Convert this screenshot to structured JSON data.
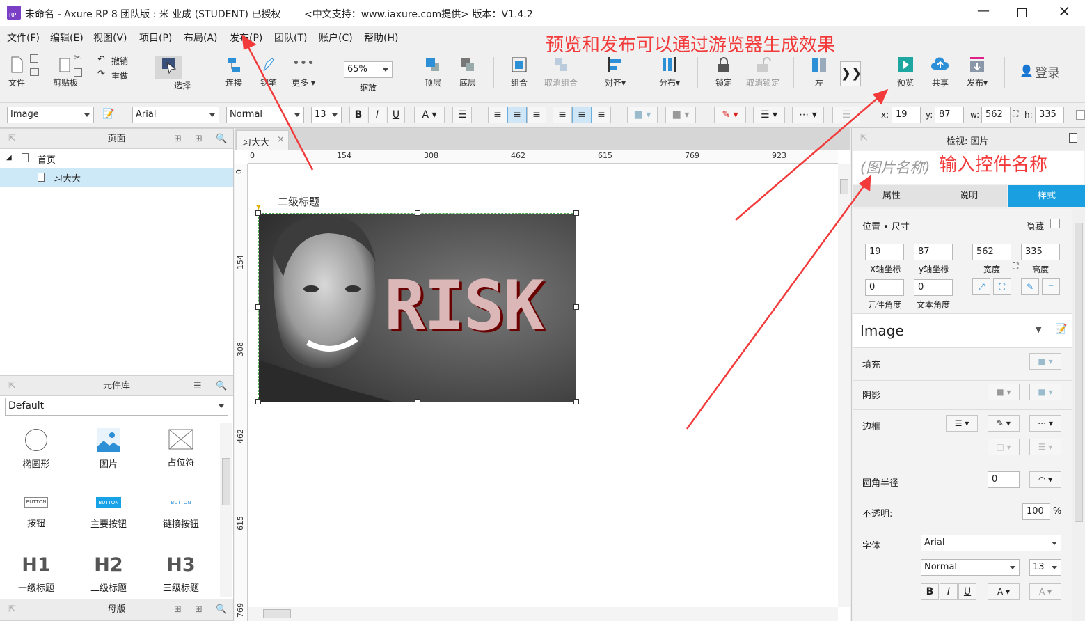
{
  "window": {
    "title": "未命名 - Axure RP 8 团队版 : 米 业成 (STUDENT) 已授权",
    "support": "<中文支持：www.iaxure.com提供> 版本：V1.4.2"
  },
  "menu": [
    "文件(F)",
    "编辑(E)",
    "视图(V)",
    "项目(P)",
    "布局(A)",
    "发布(P)",
    "团队(T)",
    "账户(C)",
    "帮助(H)"
  ],
  "toolbar": {
    "file": "文件",
    "clipboard": "剪贴板",
    "undo": "撤销",
    "redo": "重做",
    "select": "选择",
    "connect": "连接",
    "pen": "钢笔",
    "more": "更多",
    "zoom_value": "65%",
    "zoom": "缩放",
    "top": "顶层",
    "bottom": "底层",
    "group": "组合",
    "ungroup": "取消组合",
    "align": "对齐",
    "distribute": "分布",
    "lock": "锁定",
    "unlock": "取消锁定",
    "left": "左",
    "preview": "预览",
    "share": "共享",
    "publish": "发布",
    "login": "登录"
  },
  "format": {
    "style": "Image",
    "font": "Arial",
    "weight": "Normal",
    "size": "13",
    "x_label": "x:",
    "x": "19",
    "y_label": "y:",
    "y": "87",
    "w_label": "w:",
    "w": "562",
    "h_label": "h:",
    "h": "335"
  },
  "pages": {
    "title": "页面",
    "home": "首页",
    "page": "习大大"
  },
  "library": {
    "title": "元件库",
    "selected": "Default",
    "items": [
      "椭圆形",
      "图片",
      "占位符",
      "按钮",
      "主要按钮",
      "链接按钮",
      "一级标题",
      "二级标题",
      "三级标题"
    ],
    "button_text": "BUTTON",
    "h1": "H1",
    "h2": "H2",
    "h3": "H3"
  },
  "masters": {
    "title": "母版"
  },
  "canvas": {
    "tab": "习大大",
    "heading": "二级标题",
    "image_text": "RISK",
    "ruler_h": [
      "0",
      "154",
      "308",
      "462",
      "615",
      "769",
      "923"
    ],
    "ruler_v": [
      "0",
      "154",
      "308",
      "462",
      "615",
      "769"
    ]
  },
  "inspector": {
    "title": "检视: 图片",
    "name_placeholder": "(图片名称)",
    "tabs": [
      "属性",
      "说明",
      "样式"
    ],
    "position_size": "位置 • 尺寸",
    "hidden": "隐藏",
    "x": "19",
    "y": "87",
    "w": "562",
    "h": "335",
    "x_label": "X轴坐标",
    "y_label": "y轴坐标",
    "w_label": "宽度",
    "h_label": "高度",
    "angle": "0",
    "text_angle": "0",
    "angle_label": "元件角度",
    "text_angle_label": "文本角度",
    "style_name": "Image",
    "fill": "填充",
    "shadow": "阴影",
    "border": "边框",
    "radius": "圆角半径",
    "radius_value": "0",
    "opacity": "不透明:",
    "opacity_value": "100",
    "percent": "%",
    "font": "字体",
    "font_name": "Arial",
    "font_weight": "Normal",
    "font_size": "13"
  },
  "annotations": {
    "top": "预览和发布可以通过游览器生成效果",
    "right": "输入控件名称"
  }
}
